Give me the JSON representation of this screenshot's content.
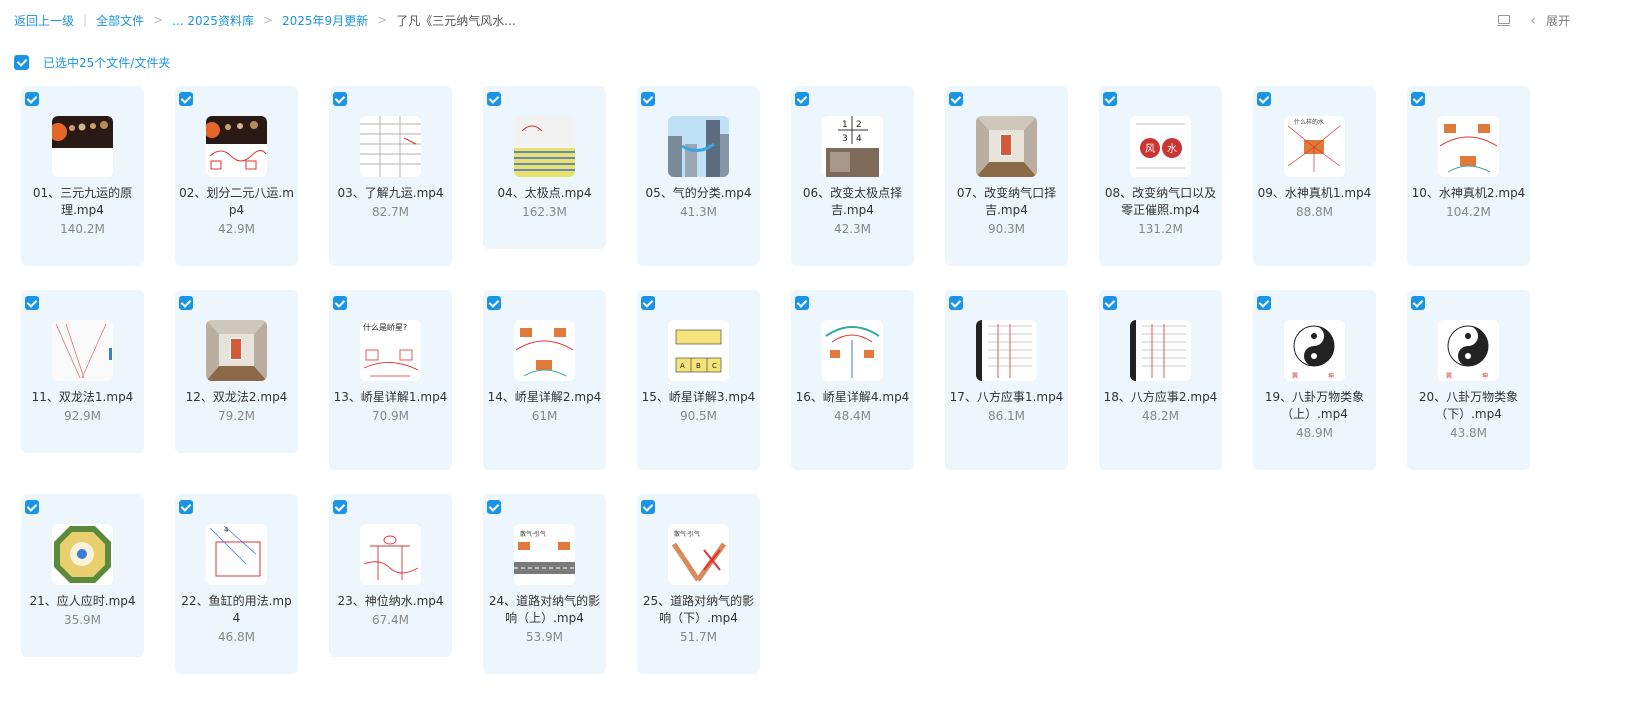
{
  "breadcrumb": {
    "back": "返回上一级",
    "items": [
      "全部文件",
      "... 2025资料库",
      "2025年9月更新",
      "了凡《三元纳气风水..."
    ]
  },
  "actions": {
    "expand": "展开"
  },
  "selection": {
    "text": "已选中25个文件/文件夹"
  },
  "files": [
    {
      "name": "01、三元九运的原理.mp4",
      "size": "140.2M",
      "thumb": "planets-icon"
    },
    {
      "name": "02、划分二元八运.mp4",
      "size": "42.9M",
      "thumb": "planets-chart-icon"
    },
    {
      "name": "03、了解九运.mp4",
      "size": "82.7M",
      "thumb": "table-icon"
    },
    {
      "name": "04、太极点.mp4",
      "size": "162.3M",
      "thumb": "spreadsheet-icon"
    },
    {
      "name": "05、气的分类.mp4",
      "size": "41.3M",
      "thumb": "buildings-icon"
    },
    {
      "name": "06、改变太极点择吉.mp4",
      "size": "42.3M",
      "thumb": "quadrant-icon"
    },
    {
      "name": "07、改变纳气口择吉.mp4",
      "size": "90.3M",
      "thumb": "room-icon"
    },
    {
      "name": "08、改变纳气口以及零正催照.mp4",
      "size": "131.2M",
      "thumb": "fengshui-icon"
    },
    {
      "name": "09、水神真机1.mp4",
      "size": "88.8M",
      "thumb": "sketch-icon"
    },
    {
      "name": "10、水神真机2.mp4",
      "size": "104.2M",
      "thumb": "sketch-orange-icon"
    },
    {
      "name": "11、双龙法1.mp4",
      "size": "92.9M",
      "thumb": "lines-icon"
    },
    {
      "name": "12、双龙法2.mp4",
      "size": "79.2M",
      "thumb": "room-icon"
    },
    {
      "name": "13、峤星详解1.mp4",
      "size": "70.9M",
      "thumb": "handwriting-icon"
    },
    {
      "name": "14、峤星详解2.mp4",
      "size": "61M",
      "thumb": "sketch-orange-icon"
    },
    {
      "name": "15、峤星详解3.mp4",
      "size": "90.5M",
      "thumb": "abc-icon"
    },
    {
      "name": "16、峤星详解4.mp4",
      "size": "48.4M",
      "thumb": "arc-icon"
    },
    {
      "name": "17、八方应事1.mp4",
      "size": "86.1M",
      "thumb": "text-doc-icon"
    },
    {
      "name": "18、八方应事2.mp4",
      "size": "48.2M",
      "thumb": "text-doc-icon"
    },
    {
      "name": "19、八卦万物类象（上）.mp4",
      "size": "48.9M",
      "thumb": "yinyang-icon"
    },
    {
      "name": "20、八卦万物类象（下）.mp4",
      "size": "43.8M",
      "thumb": "yinyang-icon"
    },
    {
      "name": "21、应人应时.mp4",
      "size": "35.9M",
      "thumb": "bagua-icon"
    },
    {
      "name": "22、鱼缸的用法.mp4",
      "size": "46.8M",
      "thumb": "diagram-icon"
    },
    {
      "name": "23、神位纳水.mp4",
      "size": "67.4M",
      "thumb": "scribble-icon"
    },
    {
      "name": "24、道路对纳气的影响（上）.mp4",
      "size": "53.9M",
      "thumb": "road-icon"
    },
    {
      "name": "25、道路对纳气的影响（下）.mp4",
      "size": "51.7M",
      "thumb": "road-cross-icon"
    }
  ],
  "colors": {
    "accent": "#1a94e6",
    "card_bg": "#ecf6fc"
  }
}
